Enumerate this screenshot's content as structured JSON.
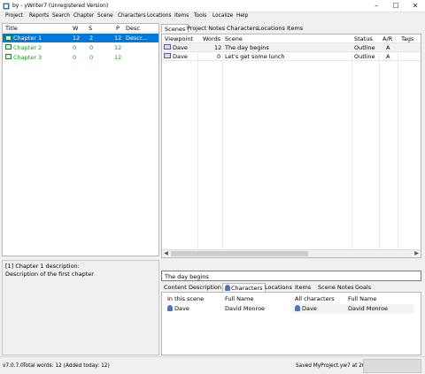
{
  "window": {
    "title": "by  - yWriter7 (Unregistered Version)",
    "minimize": "–",
    "maximize": "☐",
    "close": "✕"
  },
  "menu": [
    "Project",
    "Reports",
    "Search",
    "Chapter",
    "Scene",
    "Characters",
    "Locations",
    "Items",
    "Tools",
    "Localize",
    "Help"
  ],
  "chapter_list": {
    "headers": {
      "title": "Title",
      "w": "W",
      "s": "S",
      "p": "P",
      "desc": "Desc"
    },
    "rows": [
      {
        "title": "Chapter 1",
        "w": "12",
        "s": "2",
        "p": "12",
        "desc": "Descr..."
      },
      {
        "title": "Chapter 2",
        "w": "0",
        "s": "0",
        "p": "12",
        "desc": ""
      },
      {
        "title": "Chapter 3",
        "w": "0",
        "s": "0",
        "p": "12",
        "desc": ""
      }
    ]
  },
  "description": {
    "line1": "[1] Chapter 1 description:",
    "line2": "Description of the first chapter"
  },
  "main_tabs": [
    "Scenes",
    "Project Notes",
    "Characters",
    "Locations",
    "Items"
  ],
  "scene_list": {
    "headers": {
      "viewpoint": "Viewpoint",
      "words": "Words",
      "scene": "Scene",
      "status": "Status",
      "ar": "A/R",
      "tags": "Tags"
    },
    "rows": [
      {
        "viewpoint": "Dave",
        "words": "12",
        "scene": "The day begins",
        "status": "Outline",
        "ar": "A"
      },
      {
        "viewpoint": "Dave",
        "words": "0",
        "scene": "Let's get some lunch",
        "status": "Outline",
        "ar": "A"
      }
    ]
  },
  "scene_title": "The day begins",
  "detail_tabs": [
    "Content",
    "Description",
    "Characters",
    "Locations",
    "Items",
    "Scene Notes",
    "Goals"
  ],
  "characters_tab": {
    "headers": {
      "in_scene": "In this scene",
      "full_name": "Full Name",
      "all": "All characters",
      "full_name2": "Full Name"
    },
    "row": {
      "in_scene": "Dave",
      "full_name": "David Monroe",
      "all": "Dave",
      "full_name2": "David Monroe"
    }
  },
  "status": {
    "version": "v7.0.7.0",
    "words": "Total words: 12 (Added today: 12)",
    "saved": "Saved MyProject.yw7 at 20:43"
  },
  "colors": {
    "selection": "#0078d7",
    "chapter_green": "#1a9a1a"
  }
}
